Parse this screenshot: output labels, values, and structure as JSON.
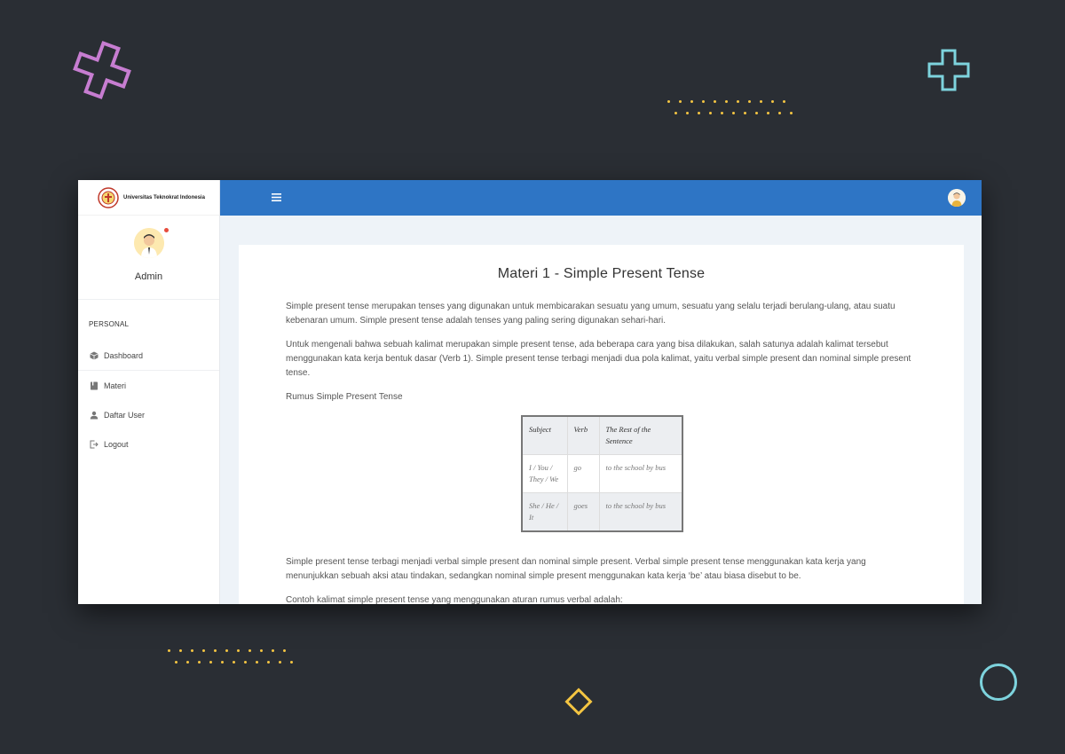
{
  "sidebar": {
    "brand_name": "Universitas Teknokrat Indonesia",
    "profile_name": "Admin",
    "section_label": "PERSONAL",
    "items": [
      {
        "label": "Dashboard",
        "icon": "cube-icon"
      },
      {
        "label": "Materi",
        "icon": "book-icon"
      },
      {
        "label": "Daftar User",
        "icon": "user-icon"
      },
      {
        "label": "Logout",
        "icon": "logout-icon"
      }
    ]
  },
  "topbar": {
    "menu_icon": "hamburger-icon",
    "color": "#2e75c5"
  },
  "content": {
    "title": "Materi 1 - Simple Present Tense",
    "paragraphs": [
      "Simple present tense merupakan tenses yang digunakan untuk membicarakan sesuatu yang umum, sesuatu yang selalu terjadi berulang-ulang, atau suatu kebenaran umum. Simple present tense adalah tenses yang paling sering digunakan sehari-hari.",
      "Untuk mengenali bahwa sebuah kalimat merupakan simple present tense, ada beberapa cara yang bisa dilakukan, salah satunya adalah kalimat tersebut menggunakan kata kerja bentuk dasar (Verb 1). Simple present tense terbagi menjadi dua pola kalimat, yaitu verbal simple present dan nominal simple present tense.",
      "Rumus Simple Present Tense"
    ],
    "table": {
      "headers": [
        "Subject",
        "Verb",
        "The Rest of the Sentence"
      ],
      "rows": [
        [
          "I / You / They / We",
          "go",
          "to the school by bus"
        ],
        [
          "She / He / It",
          "goes",
          "to the school by bus"
        ]
      ]
    },
    "lower_paragraphs": [
      "Simple present tense terbagi menjadi verbal simple present dan nominal simple present. Verbal simple present tense menggunakan kata kerja yang menunjukkan sebuah aksi atau tindakan, sedangkan nominal simple present menggunakan kata kerja ‘be’ atau biasa disebut to be.",
      "Contoh kalimat simple present tense yang menggunakan aturan rumus verbal adalah:"
    ]
  }
}
